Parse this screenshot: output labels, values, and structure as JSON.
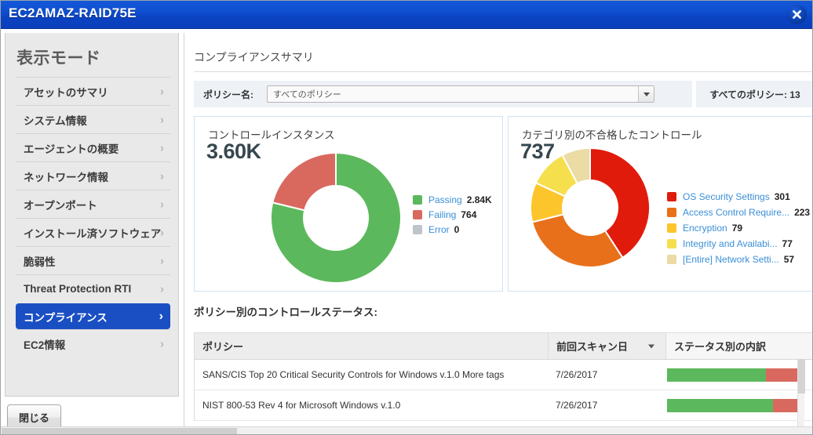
{
  "window": {
    "title": "EC2AMAZ-RAID75E",
    "close_icon": "close-icon"
  },
  "sidebar": {
    "title": "表示モード",
    "items": [
      {
        "label": "アセットのサマリ",
        "chevron": "›",
        "active": false
      },
      {
        "label": "システム情報",
        "chevron": "›",
        "active": false
      },
      {
        "label": "エージェントの概要",
        "chevron": "›",
        "active": false
      },
      {
        "label": "ネットワーク情報",
        "chevron": "›",
        "active": false
      },
      {
        "label": "オープンポート",
        "chevron": "›",
        "active": false
      },
      {
        "label": "インストール済ソフトウェア",
        "chevron": "›",
        "active": false
      },
      {
        "label": "脆弱性",
        "chevron": "›",
        "active": false
      },
      {
        "label": "Threat Protection RTI",
        "chevron": "›",
        "active": false
      },
      {
        "label": "コンプライアンス",
        "chevron": "›",
        "active": true
      },
      {
        "label": "EC2情報",
        "chevron": "›",
        "active": false
      }
    ],
    "close_button": "閉じる"
  },
  "main": {
    "heading": "コンプライアンスサマリ",
    "filter": {
      "label": "ポリシー名:",
      "selected": "すべてのポリシー",
      "options": [
        "すべてのポリシー"
      ],
      "dropdown_icon": "chevron-down-icon"
    },
    "count_badge": "すべてのポリシー: 13"
  },
  "chart_data": [
    {
      "type": "pie",
      "title": "コントロールインスタンス",
      "total_label": "3.60K",
      "total": 3600,
      "categories": [
        "Passing",
        "Failing",
        "Error"
      ],
      "values": [
        2840,
        764,
        0
      ],
      "value_labels": [
        "2.84K",
        "764",
        "0"
      ],
      "colors": [
        "#5cb85c",
        "#d9695f",
        "#bdc5cb"
      ],
      "legend_position": "right",
      "donut": true
    },
    {
      "type": "pie",
      "title": "カテゴリ別の不合格したコントロール",
      "total_label": "737",
      "total": 737,
      "categories": [
        "OS Security Settings",
        "Access Control Require...",
        "Encryption",
        "Integrity and Availabi...",
        "[Entire] Network Setti..."
      ],
      "values": [
        301,
        223,
        79,
        77,
        57
      ],
      "value_labels": [
        "301",
        "223",
        "79",
        "77",
        "57"
      ],
      "colors": [
        "#e01b0c",
        "#e8701a",
        "#fcc52c",
        "#f5df4d",
        "#ebdba4"
      ],
      "legend_position": "right",
      "donut": true
    }
  ],
  "table": {
    "caption": "ポリシー別のコントロールステータス:",
    "columns": [
      "ポリシー",
      "前回スキャン日",
      "ステータス別の内訳"
    ],
    "sorted_column_index": 1,
    "rows": [
      {
        "policy": "SANS/CIS Top 20 Critical Security Controls for Windows v.1.0 More tags",
        "last_scan": "7/26/2017",
        "passing_pct": 72,
        "failing_pct": 28
      },
      {
        "policy": "NIST 800-53 Rev 4 for Microsoft Windows v.1.0",
        "last_scan": "7/26/2017",
        "passing_pct": 77,
        "failing_pct": 23
      }
    ]
  },
  "colors": {
    "accent": "#0b43c2",
    "pass": "#5cb85c",
    "fail": "#d9695f",
    "link": "#3b8fd6"
  }
}
